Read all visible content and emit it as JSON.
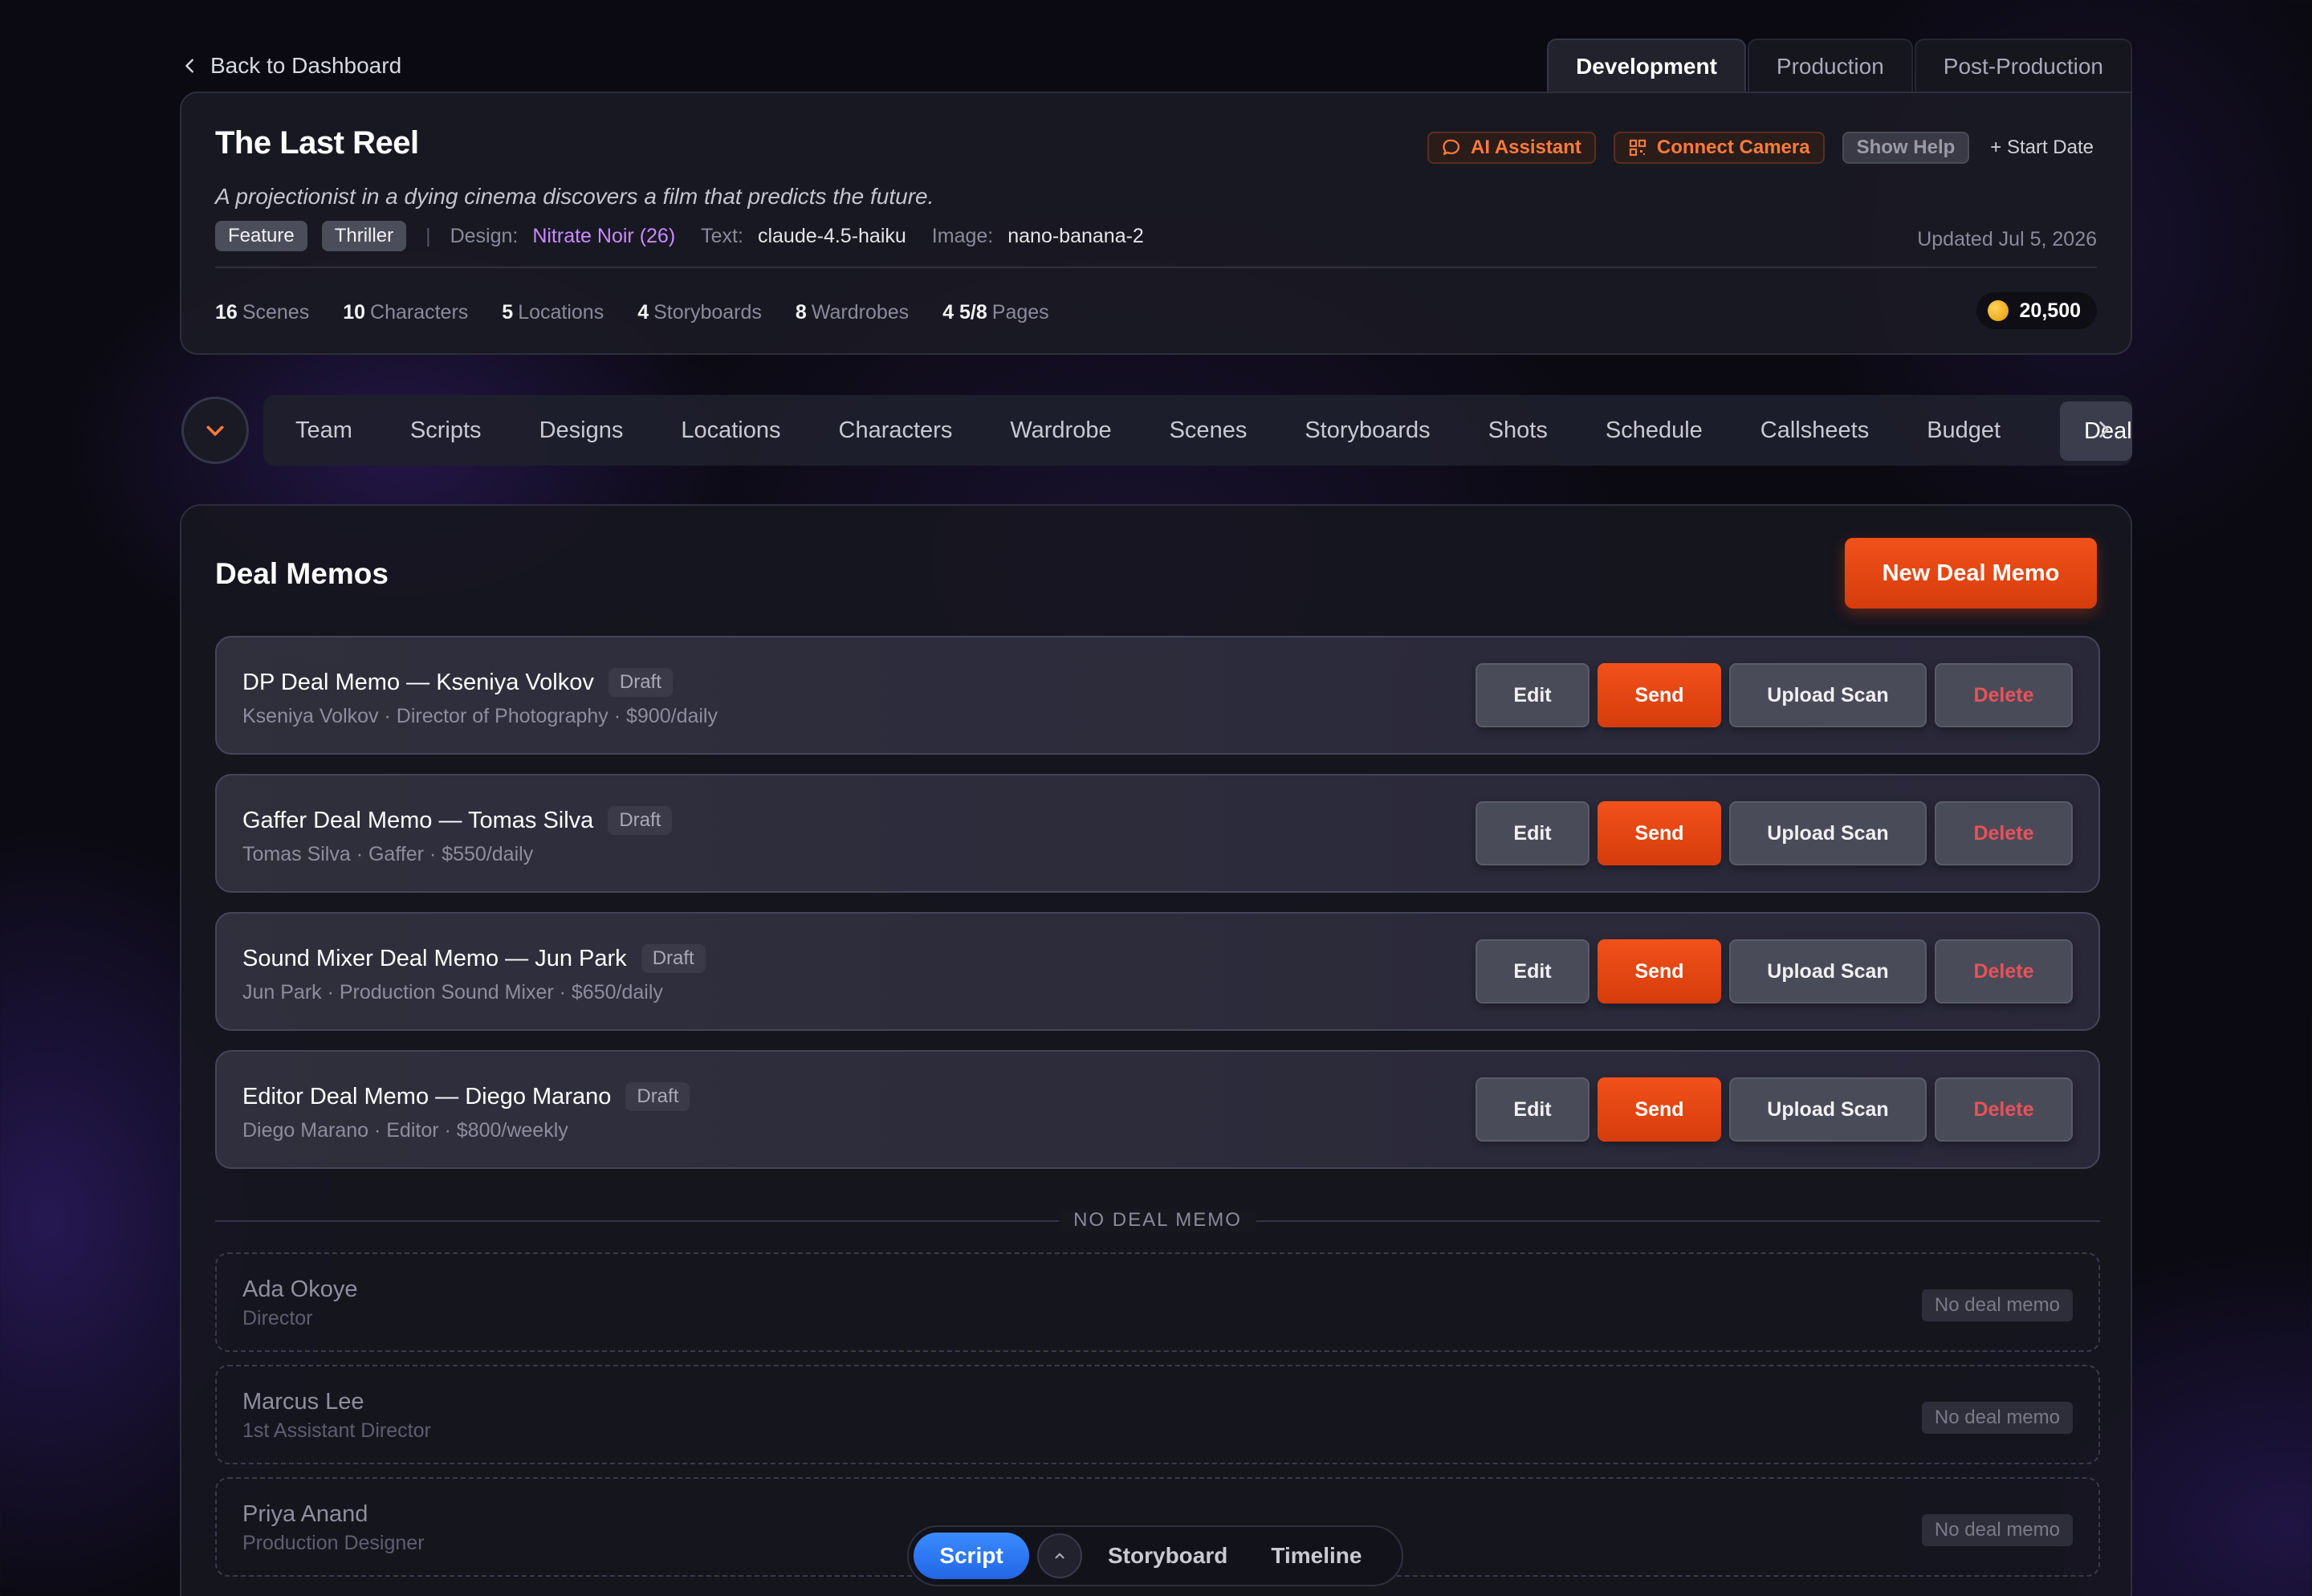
{
  "nav": {
    "back_label": "Back to Dashboard"
  },
  "phases": [
    "Development",
    "Production",
    "Post-Production"
  ],
  "project": {
    "title": "The Last Reel",
    "logline": "A projectionist in a dying cinema discovers a film that predicts the future.",
    "tags": [
      "Feature",
      "Thriller"
    ],
    "design_label": "Design:",
    "design_value": "Nitrate Noir (26)",
    "text_label": "Text:",
    "text_value": "claude-4.5-haiku",
    "image_label": "Image:",
    "image_value": "nano-banana-2",
    "updated": "Updated Jul 5, 2026",
    "actions": {
      "ai_assistant": "AI Assistant",
      "connect_camera": "Connect Camera",
      "show_help": "Show Help",
      "start_date": "+ Start Date"
    },
    "stats": [
      {
        "value": "16",
        "label": "Scenes"
      },
      {
        "value": "10",
        "label": "Characters"
      },
      {
        "value": "5",
        "label": "Locations"
      },
      {
        "value": "4",
        "label": "Storyboards"
      },
      {
        "value": "8",
        "label": "Wardrobes"
      },
      {
        "value": "4 5/8",
        "label": "Pages"
      }
    ],
    "credits": "20,500"
  },
  "sections": [
    "Team",
    "Scripts",
    "Designs",
    "Locations",
    "Characters",
    "Wardrobe",
    "Scenes",
    "Storyboards",
    "Shots",
    "Schedule",
    "Callsheets",
    "Budget",
    "Deal"
  ],
  "deal_memos": {
    "title": "Deal Memos",
    "new_button": "New Deal Memo",
    "action_labels": {
      "edit": "Edit",
      "send": "Send",
      "upload": "Upload Scan",
      "delete": "Delete"
    },
    "items": [
      {
        "title": "DP Deal Memo — Kseniya Volkov",
        "status": "Draft",
        "subtitle": "Kseniya Volkov · Director of Photography · $900/daily"
      },
      {
        "title": "Gaffer Deal Memo — Tomas Silva",
        "status": "Draft",
        "subtitle": "Tomas Silva · Gaffer · $550/daily"
      },
      {
        "title": "Sound Mixer Deal Memo — Jun Park",
        "status": "Draft",
        "subtitle": "Jun Park · Production Sound Mixer · $650/daily"
      },
      {
        "title": "Editor Deal Memo — Diego Marano",
        "status": "Draft",
        "subtitle": "Diego Marano · Editor · $800/weekly"
      }
    ],
    "divider_label": "NO DEAL MEMO",
    "no_memo_badge": "No deal memo",
    "without_memo": [
      {
        "name": "Ada Okoye",
        "role": "Director"
      },
      {
        "name": "Marcus Lee",
        "role": "1st Assistant Director"
      },
      {
        "name": "Priya Anand",
        "role": "Production Designer"
      }
    ]
  },
  "view_switcher": {
    "script": "Script",
    "storyboard": "Storyboard",
    "timeline": "Timeline"
  }
}
